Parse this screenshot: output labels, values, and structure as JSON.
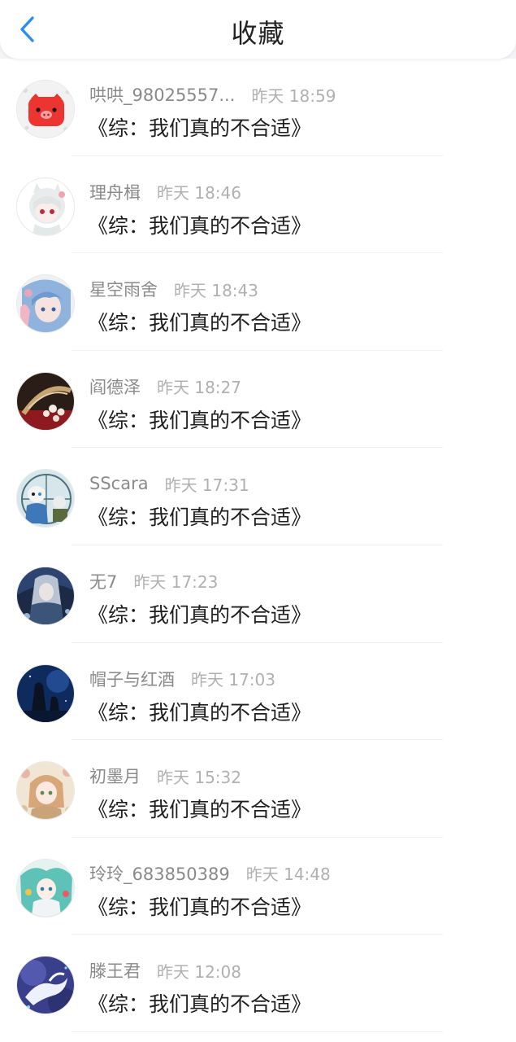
{
  "header": {
    "title": "收藏",
    "back_icon": "chevron-left-icon",
    "accent_color": "#2d8cf0"
  },
  "favorites": [
    {
      "user": "哄哄_98025557...",
      "time": "昨天 18:59",
      "title": "《综：我们真的不合适》",
      "avatar": "pig-face-avatar"
    },
    {
      "user": "理舟楫",
      "time": "昨天 18:46",
      "title": "《综：我们真的不合适》",
      "avatar": "anime-cat-girl-avatar"
    },
    {
      "user": "星空雨舍",
      "time": "昨天 18:43",
      "title": "《综：我们真的不合适》",
      "avatar": "anime-blue-hair-avatar"
    },
    {
      "user": "阎德泽",
      "time": "昨天 18:27",
      "title": "《综：我们真的不合适》",
      "avatar": "pearl-brooch-avatar"
    },
    {
      "user": "SScara",
      "time": "昨天 17:31",
      "title": "《综：我们真的不合适》",
      "avatar": "skeleton-characters-avatar"
    },
    {
      "user": "无7",
      "time": "昨天 17:23",
      "title": "《综：我们真的不合适》",
      "avatar": "anime-silver-hair-avatar"
    },
    {
      "user": "帽子与红酒",
      "time": "昨天 17:03",
      "title": "《综：我们真的不合适》",
      "avatar": "night-silhouette-avatar"
    },
    {
      "user": "初墨月",
      "time": "昨天 15:32",
      "title": "《综：我们真的不合适》",
      "avatar": "anime-floral-girl-avatar"
    },
    {
      "user": "玲玲_683850389",
      "time": "昨天 14:48",
      "title": "《综：我们真的不合适》",
      "avatar": "anime-teal-hair-avatar"
    },
    {
      "user": "滕王君",
      "time": "昨天 12:08",
      "title": "《综：我们真的不合适》",
      "avatar": "white-dragon-avatar"
    }
  ]
}
